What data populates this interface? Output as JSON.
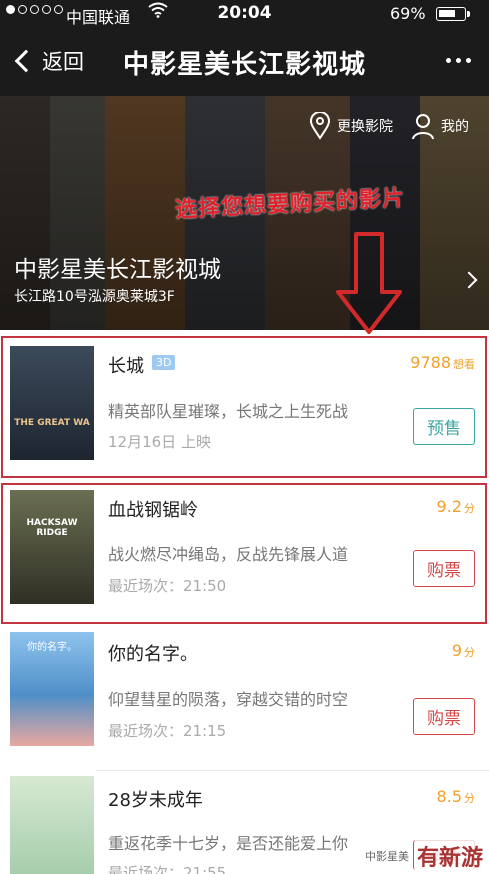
{
  "status_bar": {
    "carrier": "中国联通",
    "time": "20:04",
    "battery": "69%",
    "battery_level": 0.69
  },
  "nav": {
    "back_label": "返回",
    "title": "中影星美长江影视城"
  },
  "banner": {
    "change_cinema": "更换影院",
    "my": "我的",
    "instruction": "选择您想要购买的影片",
    "cinema_name": "中影星美长江影视城",
    "cinema_address": "长江路10号泓源奥莱城3F"
  },
  "movies": [
    {
      "title": "长城",
      "badge": "3D",
      "score": "9788",
      "score_unit": "想看",
      "desc": "精英部队星璀璨，长城之上生死战",
      "schedule": "12月16日 上映",
      "button": "预售",
      "poster_caption": "THE GREAT WA"
    },
    {
      "title": "血战钢锯岭",
      "score": "9.2",
      "score_unit": "分",
      "desc": "战火燃尽冲绳岛，反战先锋展人道",
      "schedule": "最近场次：21:50",
      "button": "购票",
      "poster_caption": "HACKSAW RIDGE"
    },
    {
      "title": "你的名字。",
      "score": "9",
      "score_unit": "分",
      "desc": "仰望彗星的陨落，穿越交错的时空",
      "schedule": "最近场次：21:15",
      "button": "购票",
      "poster_caption": "你的名字。"
    },
    {
      "title": "28岁未成年",
      "score": "8.5",
      "score_unit": "分",
      "desc": "重返花季十七岁，是否还能爱上你",
      "schedule": "最近场次：21:55",
      "button": "购票"
    }
  ],
  "watermark": {
    "account": "中影星美",
    "logo": "有新游"
  },
  "colors": {
    "highlight": "#c2343f",
    "score": "#f2a12a",
    "presale": "#3aa7a3",
    "buy": "#d14a4a"
  }
}
